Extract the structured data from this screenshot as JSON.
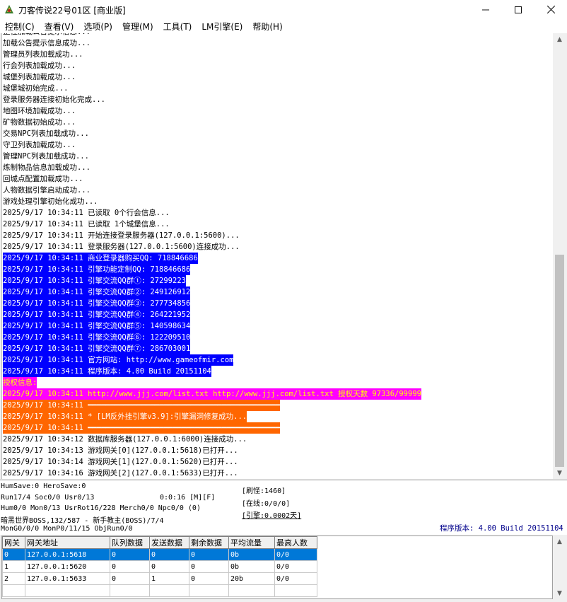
{
  "window": {
    "title": "刀客传说22号01区 [商业版]",
    "minimize": "—",
    "maximize": "☐",
    "close": "✕"
  },
  "menu": [
    "控制(C)",
    "查看(V)",
    "选项(P)",
    "管理(M)",
    "工具(T)",
    "LM引擎(E)",
    "帮助(H)"
  ],
  "log": [
    {
      "text": "正在加载公告提示信息...",
      "style": "plain"
    },
    {
      "text": "加载公告提示信息成功...",
      "style": "plain"
    },
    {
      "text": "管理员列表加载成功...",
      "style": "plain"
    },
    {
      "text": "行会列表加载成功...",
      "style": "plain"
    },
    {
      "text": "城堡列表加载成功...",
      "style": "plain"
    },
    {
      "text": "城堡城初始完成...",
      "style": "plain"
    },
    {
      "text": "登录服务器连接初始化完成...",
      "style": "plain"
    },
    {
      "text": "地图环境加载成功...",
      "style": "plain"
    },
    {
      "text": "矿物数据初始成功...",
      "style": "plain"
    },
    {
      "text": "交易NPC列表加载成功...",
      "style": "plain"
    },
    {
      "text": "守卫列表加载成功...",
      "style": "plain"
    },
    {
      "text": "管理NPC列表加载成功...",
      "style": "plain"
    },
    {
      "text": "炼制物品信息加载成功...",
      "style": "plain"
    },
    {
      "text": "回城点配置加载成功...",
      "style": "plain"
    },
    {
      "text": "人物数据引擎启动成功...",
      "style": "plain"
    },
    {
      "text": "游戏处理引擎初始化成功...",
      "style": "plain"
    },
    {
      "text": "2025/9/17 10:34:11 已读取 0个行会信息...",
      "style": "plain"
    },
    {
      "text": "2025/9/17 10:34:11 已读取 1个城堡信息...",
      "style": "plain"
    },
    {
      "text": "2025/9/17 10:34:11 开始连接登录服务器(127.0.0.1:5600)...",
      "style": "plain"
    },
    {
      "text": "2025/9/17 10:34:11 登录服务器(127.0.0.1:5600)连接成功...",
      "style": "plain"
    },
    {
      "text": "2025/9/17 10:34:11 商业登录器购买QQ: 718846686",
      "style": "blue"
    },
    {
      "text": "2025/9/17 10:34:11 引擎功能定制QQ: 718846686",
      "style": "blue"
    },
    {
      "text": "2025/9/17 10:34:11 引擎交流QQ群①: 27299223",
      "style": "blue"
    },
    {
      "text": "2025/9/17 10:34:11 引擎交流QQ群②: 249126912",
      "style": "blue"
    },
    {
      "text": "2025/9/17 10:34:11 引擎交流QQ群③: 277734856",
      "style": "blue"
    },
    {
      "text": "2025/9/17 10:34:11 引擎交流QQ群④: 264221952",
      "style": "blue"
    },
    {
      "text": "2025/9/17 10:34:11 引擎交流QQ群⑤: 140598634",
      "style": "blue"
    },
    {
      "text": "2025/9/17 10:34:11 引擎交流QQ群⑥: 122209510",
      "style": "blue"
    },
    {
      "text": "2025/9/17 10:34:11 引擎交流QQ群⑦: 286703001",
      "style": "blue"
    },
    {
      "text": "2025/9/17 10:34:11 官方网站: http://www.gameofmir.com",
      "style": "blue"
    },
    {
      "text": "2025/9/17 10:34:11 程序版本: 4.00 Build 20151104",
      "style": "blue"
    },
    {
      "text": "授权信息:",
      "style": "magenta"
    },
    {
      "text": "2025/9/17 10:34:11 http://www.jjj.com/list.txt http://www.jjj.com/list.txt 授权天数 97336/99999",
      "style": "magenta"
    },
    {
      "text": "2025/9/17 10:34:11 ━━━━━━━━━━━━━━━━━━━━━━━━━━━━━━━━━━━━━━━━━━━",
      "style": "orange"
    },
    {
      "text": "2025/9/17 10:34:11 * [LM反外挂引擎v3.9]:引擎漏洞修复成功...",
      "style": "orange"
    },
    {
      "text": "2025/9/17 10:34:11 ━━━━━━━━━━━━━━━━━━━━━━━━━━━━━━━━━━━━━━━━━━━",
      "style": "orange"
    },
    {
      "text": "2025/9/17 10:34:12 数据库服务器(127.0.0.1:6000)连接成功...",
      "style": "plain"
    },
    {
      "text": "2025/9/17 10:34:13 游戏网关[0](127.0.0.1:5618)已打开...",
      "style": "plain"
    },
    {
      "text": "2025/9/17 10:34:14 游戏网关[1](127.0.0.1:5620)已打开...",
      "style": "plain"
    },
    {
      "text": "2025/9/17 10:34:16 游戏网关[2](127.0.0.1:5633)已打开...",
      "style": "plain"
    }
  ],
  "status": {
    "line1": "HumSave:0 HeroSave:0",
    "line2a": "Run17/4 Soc0/0 Usr0/13",
    "line2b": "0:0:16 [M][F]",
    "line3": "Hum0/0 Mon0/13 UsrRot16/228 Merch0/0 Npc0/0 (0)",
    "line4": "暗黑世界BOSS,132/587 - 新手教主(BOSS)/7/4",
    "line5": "MonG0/0/0 MonP0/11/15 ObjRun0/0",
    "refresh_monster": "[刷怪:1460]",
    "online": "[在线:0/0/0]",
    "engine": "[引擎:0.0002天]",
    "version": "程序版本: 4.00 Build 20151104"
  },
  "grid": {
    "headers": [
      "网关",
      "网关地址",
      "队列数据",
      "发送数据",
      "剩余数据",
      "平均流量",
      "最高人数"
    ],
    "rows": [
      [
        "0",
        "127.0.0.1:5618",
        "0",
        "0",
        "0",
        "0b",
        "0/0"
      ],
      [
        "1",
        "127.0.0.1:5620",
        "0",
        "0",
        "0",
        "0b",
        "0/0"
      ],
      [
        "2",
        "127.0.0.1:5633",
        "0",
        "1",
        "0",
        "20b",
        "0/0"
      ],
      [
        "",
        "",
        "",
        "",
        "",
        "",
        ""
      ]
    ],
    "selected_row": 0
  },
  "colors": {
    "highlight_blue": "#0000ff",
    "highlight_magenta": "#ff00ff",
    "highlight_orange": "#ff6600",
    "selection": "#0078d7",
    "version_text": "#00008b"
  }
}
